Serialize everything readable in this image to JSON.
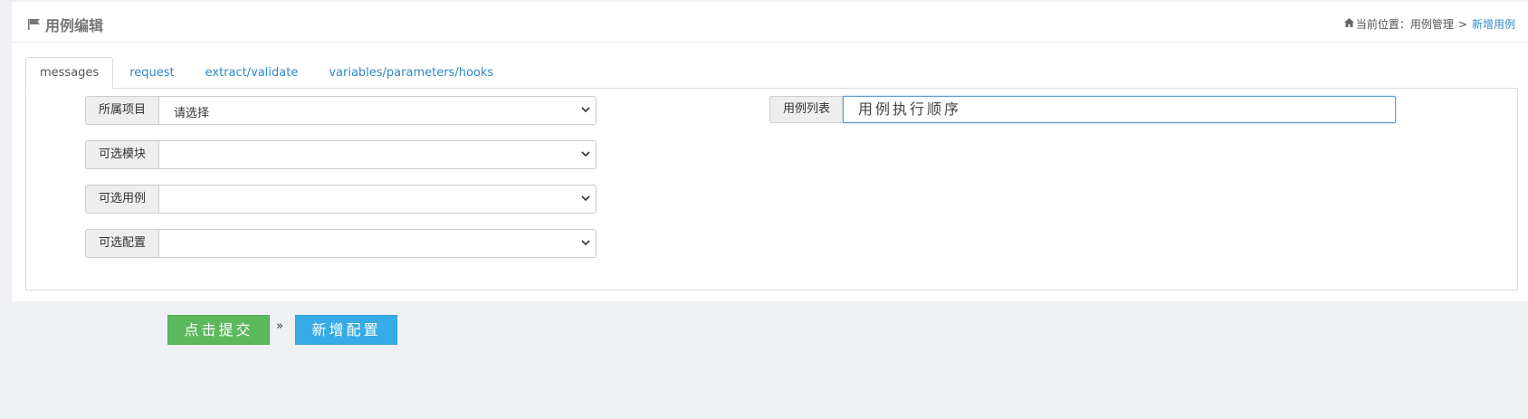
{
  "header": {
    "title": "用例编辑",
    "breadcrumb": {
      "prefix": "当前位置：",
      "parent": "用例管理",
      "separator": ">",
      "current": "新增用例"
    }
  },
  "tabs": [
    {
      "label": "messages",
      "active": true
    },
    {
      "label": "request",
      "active": false
    },
    {
      "label": "extract/validate",
      "active": false
    },
    {
      "label": "variables/parameters/hooks",
      "active": false
    }
  ],
  "form": {
    "fields": [
      {
        "label": "所属项目",
        "value": "请选择"
      },
      {
        "label": "可选模块",
        "value": ""
      },
      {
        "label": "可选用例",
        "value": ""
      },
      {
        "label": "可选配置",
        "value": ""
      }
    ],
    "case_list": {
      "label": "用例列表",
      "value": "用例执行顺序"
    }
  },
  "actions": {
    "submit_label": "点击提交",
    "separator": "»",
    "add_config_label": "新增配置"
  },
  "colors": {
    "link": "#2f8ac9",
    "submit": "#5cb85c",
    "add_config": "#36abe6"
  }
}
